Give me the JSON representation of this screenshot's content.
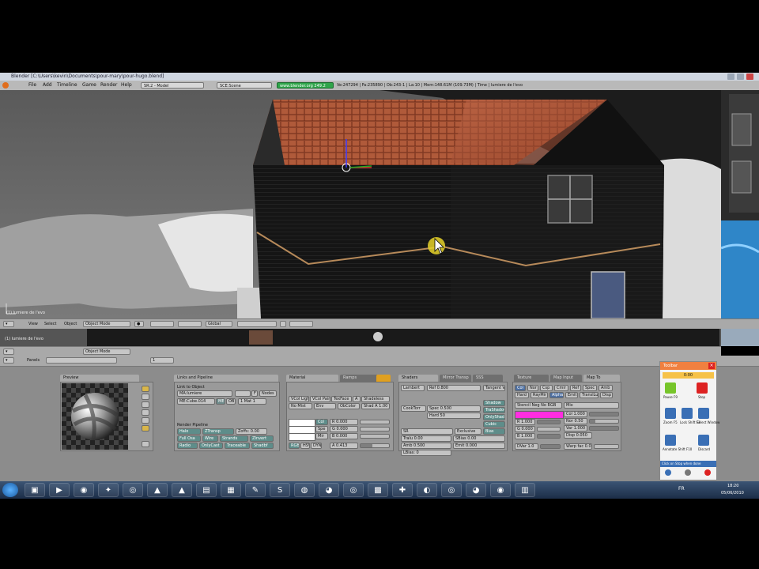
{
  "window": {
    "title": "Blender [C:\\Users\\kevin\\Documents\\pour-mary\\pour-hugo.blend]"
  },
  "menubar": {
    "items": [
      "File",
      "Add",
      "Timeline",
      "Game",
      "Render",
      "Help"
    ],
    "screen": "SR:2 - Model",
    "scene": "SCE:Scene",
    "site": "www.blender.org 249.2",
    "stats": "Ve:247294 | Fa:235890 | Ob:243-1 | La:10 | Mem:148.61M (109.73M) | Time | lumiere de l'evo"
  },
  "viewport": {
    "label": "(1) lumiere de l'evo",
    "header": {
      "view": "View",
      "select": "Select",
      "object": "Object",
      "mode": "Object Mode",
      "orientation": "Global"
    }
  },
  "viewport2": {
    "label": "(1) lumiere de l'evo",
    "mode": "Object Mode"
  },
  "buttons_header": {
    "panels": "Panels",
    "frame": "1"
  },
  "preview": {
    "tab": "Preview"
  },
  "links": {
    "tabs": [
      "Links and Pipeline"
    ],
    "link_to_object": "Link to Object",
    "ma": "MA:lumiere",
    "f": "F",
    "nodes": "Nodes",
    "me": "ME:Cube.014",
    "ob": "OB",
    "ma_count": "1 Mat 1",
    "render_pipeline": "Render Pipeline",
    "pipeline_buttons": [
      "Halo",
      "ZTransp",
      "Zoffs: 0.00",
      "Full Osa",
      "Wire",
      "Strands",
      "ZInvert",
      "Radio",
      "OnlyCast",
      "Traceable",
      "Shadbf"
    ]
  },
  "material": {
    "tabs": [
      "Material",
      "Ramps"
    ],
    "row1": [
      "VCol Light",
      "VCol Paint",
      "TexFace",
      "A",
      "Shadeless"
    ],
    "row2": [
      "No Mist",
      "Env",
      "ObColor",
      "Shad A 1.00"
    ],
    "col": "Col",
    "spe": "Spe",
    "mir": "Mir",
    "r": "R 0.000",
    "g": "G 0.000",
    "b": "B 0.000",
    "rgb": "RGB",
    "hsv": "HSV",
    "dyn": "DYN",
    "a": "A 0.413"
  },
  "shaders": {
    "tabs": [
      "Shaders",
      "Mirror Transp",
      "SSS"
    ],
    "lambert": "Lambert",
    "ref": "Ref 0.800",
    "tangent_v": "Tangent V",
    "cooktorr": "CookTorr",
    "spec": "Spec 0.500",
    "hard": "Hard 50",
    "right": [
      "Shadow",
      "TraShadow",
      "OnlyShad",
      "Cubic",
      "Bias"
    ],
    "sr": "SR",
    "exclusive": "Exclusive",
    "tralu": "Tralu 0.00",
    "sbias": "SBias 0.00",
    "amb": "Amb 0.500",
    "emit": "Emit 0.000",
    "lbias": "LBias: 0"
  },
  "texture": {
    "tabs": [
      "Texture",
      "Map Input",
      "Map To"
    ],
    "row1": [
      "Col",
      "Nor",
      "Csp",
      "Cmir",
      "Ref",
      "Spec",
      "Amb"
    ],
    "row2": [
      "Hard",
      "RayMir",
      "Alpha",
      "Emit",
      "TranslLu",
      "Disp"
    ],
    "stencil": "Stencil Neg No RGB",
    "mix": "Mix",
    "col": "Col 1.000",
    "nor": "Nor 0.50",
    "var": "Var 1.000",
    "disp": "Disp 0.050",
    "r": "R 1.000",
    "g": "G 0.000",
    "b": "B 1.000",
    "dvar": "DVar 1.0",
    "warp": "Warp fac 0.0",
    "swatch": "#ff2de0"
  },
  "remote": {
    "title": "Toolbar",
    "value": "0:00",
    "buttons": [
      "Pause F9",
      "Stop",
      "Zoom F5",
      "Lock Shift F3",
      "Select Window",
      "Annotate Shift F10",
      "Discard"
    ],
    "footer": "Click on Stop when done"
  },
  "taskbar": {
    "lang": "FR",
    "time": "18:20",
    "date": "05/06/2010"
  },
  "colors": {
    "accent_green": "#2fa54a",
    "magenta": "#ff2de0",
    "taskbar": "#2b4366"
  }
}
